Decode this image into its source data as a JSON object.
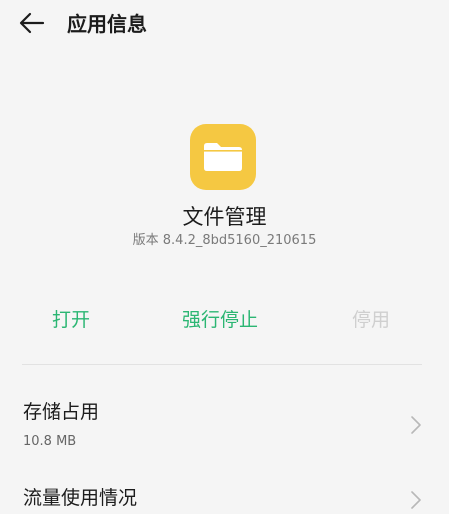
{
  "header": {
    "back_icon": "arrow-left-icon",
    "title": "应用信息"
  },
  "app": {
    "icon": "folder-icon",
    "icon_background": "#F5C842",
    "name": "文件管理",
    "version": "版本 8.4.2_8bd5160_210615"
  },
  "actions": {
    "open": {
      "label": "打开",
      "color": "#2BB673",
      "enabled": true
    },
    "force_stop": {
      "label": "强行停止",
      "color": "#2BB673",
      "enabled": true
    },
    "disable": {
      "label": "停用",
      "color": "#CFCFCF",
      "enabled": false
    }
  },
  "settings": [
    {
      "title": "存储占用",
      "subtitle": "10.8 MB",
      "icon": "chevron-right-icon"
    },
    {
      "title": "流量使用情况",
      "icon": "chevron-right-icon"
    }
  ]
}
